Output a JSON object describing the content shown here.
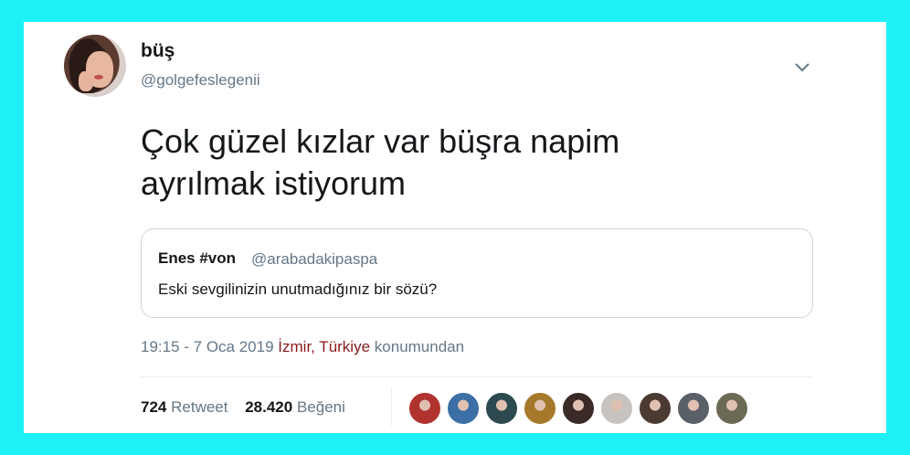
{
  "author": {
    "name": "büş",
    "handle": "@golgefeslegenii"
  },
  "tweet": {
    "text_line1": "Çok güzel kızlar var büşra napim",
    "text_line2": "ayrılmak istiyorum"
  },
  "quoted_tweet": {
    "name": "Enes #von",
    "handle": "@arabadakipaspa",
    "text": "Eski sevgilinizin unutmadığınız bir sözü?"
  },
  "meta": {
    "timestamp": "19:15 - 7 Oca 2019",
    "location": "İzmir, Türkiye",
    "location_suffix": "konumundan"
  },
  "stats": {
    "retweet_count": "724",
    "retweet_label": "Retweet",
    "like_count": "28.420",
    "like_label": "Beğeni"
  },
  "colors": {
    "background": "#1ef1f6",
    "location_link": "#8b1a1a",
    "secondary_text": "#657786"
  },
  "icons": {
    "menu": "chevron-down-icon"
  },
  "likers": [
    {
      "color": "#b0332f"
    },
    {
      "color": "#3b6fa5"
    },
    {
      "color": "#2d4a50"
    },
    {
      "color": "#a5782a"
    },
    {
      "color": "#3a2a28"
    },
    {
      "color": "#c9c3bf"
    },
    {
      "color": "#4a3a32"
    },
    {
      "color": "#5a6068"
    },
    {
      "color": "#6c6a55"
    }
  ]
}
